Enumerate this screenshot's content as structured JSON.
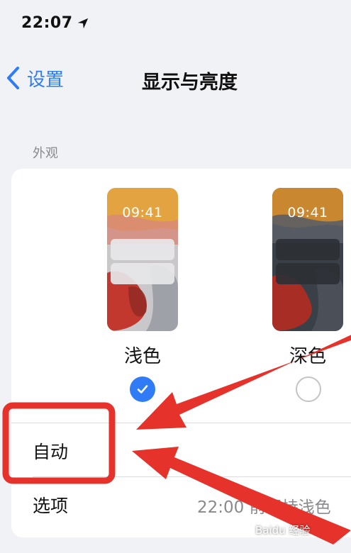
{
  "status_bar": {
    "time": "22:07"
  },
  "nav": {
    "back_label": "设置",
    "title": "显示与亮度"
  },
  "appearance": {
    "section_header": "外观",
    "options": [
      {
        "label": "浅色",
        "preview_time": "09:41",
        "selected": true
      },
      {
        "label": "深色",
        "preview_time": "09:41",
        "selected": false
      }
    ]
  },
  "rows": {
    "auto_label": "自动",
    "options_label": "选项",
    "options_value": "22:00 前保持浅色"
  },
  "watermark": "Baidu 经验",
  "colors": {
    "accent": "#2f7cf6",
    "annotation": "#e5322b",
    "background": "#f1f2f6"
  }
}
